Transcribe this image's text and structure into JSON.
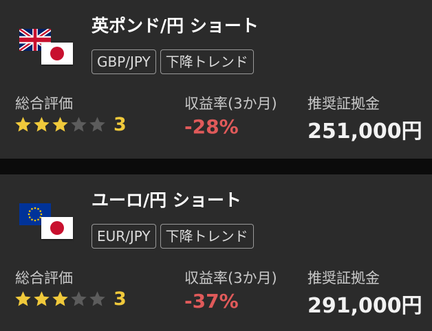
{
  "labels": {
    "rating": "総合評価",
    "return": "収益率(3か月)",
    "margin": "推奨証拠金"
  },
  "colors": {
    "star_on": "#f0c93b",
    "star_off": "#5c5c5c",
    "negative": "#e05a5a"
  },
  "cards": [
    {
      "title": "英ポンド/円 ショート",
      "base_flag": "uk-flag-icon",
      "quote_flag": "japan-flag-icon",
      "tags": [
        "GBP/JPY",
        "下降トレンド"
      ],
      "rating": 3,
      "rating_max": 5,
      "rating_text": "3",
      "return": "-28%",
      "margin": "251,000円"
    },
    {
      "title": "ユーロ/円 ショート",
      "base_flag": "eu-flag-icon",
      "quote_flag": "japan-flag-icon",
      "tags": [
        "EUR/JPY",
        "下降トレンド"
      ],
      "rating": 3,
      "rating_max": 5,
      "rating_text": "3",
      "return": "-37%",
      "margin": "291,000円"
    }
  ]
}
